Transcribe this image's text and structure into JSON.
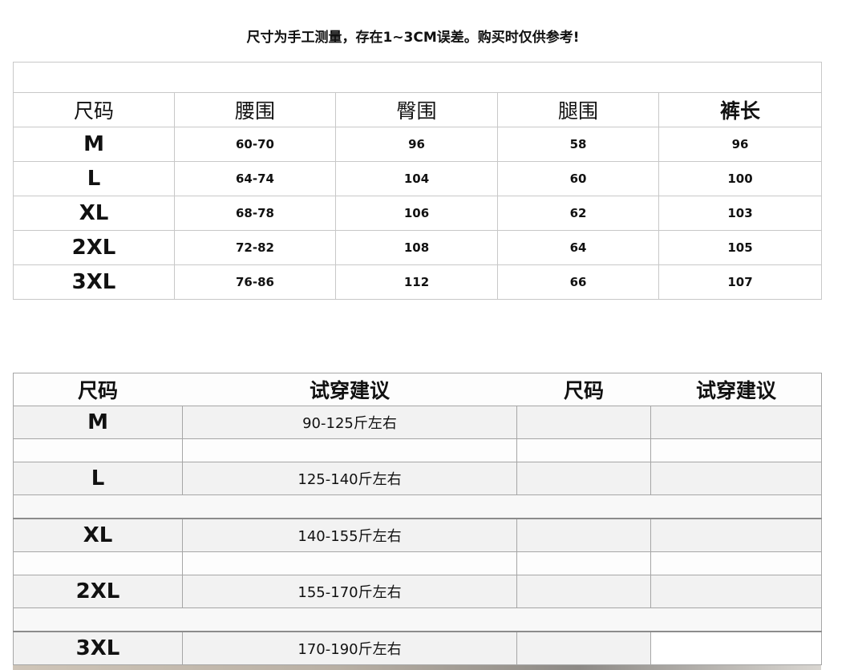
{
  "notice": "尺寸为手工测量，存在1~3CM误差。购买时仅供参考!",
  "size_table": {
    "headers": [
      "尺码",
      "腰围",
      "臀围",
      "腿围",
      "裤长"
    ],
    "rows": [
      [
        "M",
        "60-70",
        "96",
        "58",
        "96"
      ],
      [
        "L",
        "64-74",
        "104",
        "60",
        "100"
      ],
      [
        "XL",
        "68-78",
        "106",
        "62",
        "103"
      ],
      [
        "2XL",
        "72-82",
        "108",
        "64",
        "105"
      ],
      [
        "3XL",
        "76-86",
        "112",
        "66",
        "107"
      ]
    ]
  },
  "fit_table": {
    "headers": [
      "尺码",
      "试穿建议",
      "尺码",
      "试穿建议"
    ],
    "rows": [
      {
        "size": "M",
        "advice": "90-125斤左右"
      },
      {
        "size": "L",
        "advice": "125-140斤左右"
      },
      {
        "size": "XL",
        "advice": "140-155斤左右"
      },
      {
        "size": "2XL",
        "advice": "155-170斤左右"
      },
      {
        "size": "3XL",
        "advice": "170-190斤左右"
      }
    ]
  }
}
